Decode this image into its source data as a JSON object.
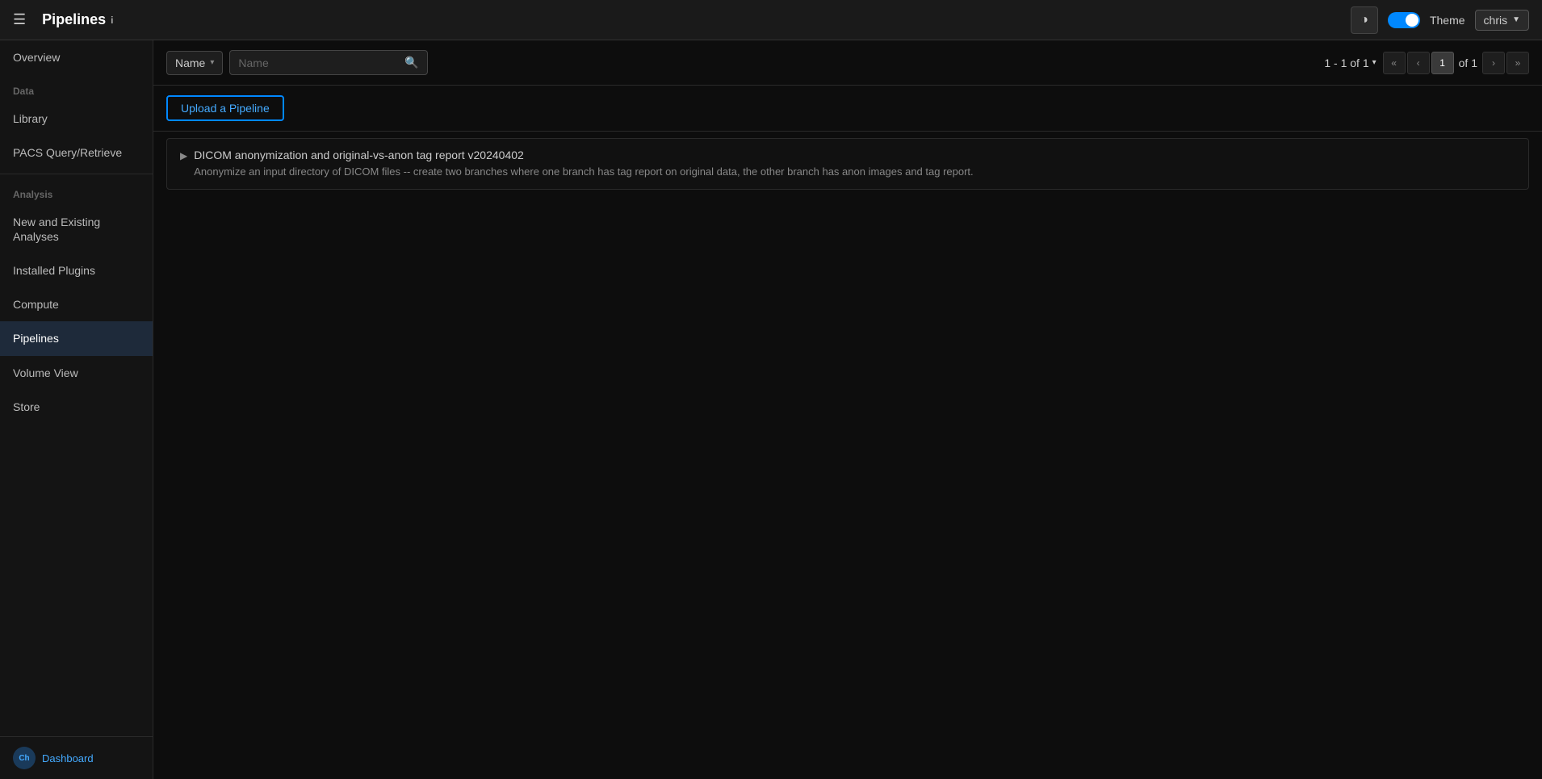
{
  "topnav": {
    "hamburger_label": "☰",
    "title": "Pipelines",
    "title_sup": "i",
    "theme_icon": "◑",
    "theme_label": "Theme",
    "user_label": "chris",
    "user_chevron": "▼"
  },
  "sidebar": {
    "items": [
      {
        "id": "overview",
        "label": "Overview",
        "active": false,
        "section": null
      },
      {
        "id": "data",
        "label": "Data",
        "active": false,
        "section": "section"
      },
      {
        "id": "library",
        "label": "Library",
        "active": false,
        "section": null
      },
      {
        "id": "pacs",
        "label": "PACS Query/Retrieve",
        "active": false,
        "section": null
      },
      {
        "id": "analysis-section",
        "label": "Analysis",
        "active": false,
        "section": "section"
      },
      {
        "id": "new-and-existing",
        "label": "New and Existing Analyses",
        "active": false,
        "section": null
      },
      {
        "id": "installed-plugins",
        "label": "Installed Plugins",
        "active": false,
        "section": null
      },
      {
        "id": "compute",
        "label": "Compute",
        "active": false,
        "section": null
      },
      {
        "id": "pipelines",
        "label": "Pipelines",
        "active": true,
        "section": null
      },
      {
        "id": "volume-view",
        "label": "Volume View",
        "active": false,
        "section": null
      },
      {
        "id": "store",
        "label": "Store",
        "active": false,
        "section": null
      }
    ],
    "bottom": {
      "logo_text": "Ch",
      "dashboard_label": "Dashboard"
    }
  },
  "toolbar": {
    "filter": {
      "label": "Name",
      "chevron": "▾"
    },
    "search": {
      "placeholder": "Name",
      "icon": "🔍"
    },
    "pagination": {
      "range": "1 - 1 of 1",
      "chevron": "▾",
      "current_page": "1",
      "total_pages": "of 1",
      "first": "«",
      "prev": "‹",
      "next": "›",
      "last": "»"
    }
  },
  "upload_btn_label": "Upload a Pipeline",
  "pipelines": [
    {
      "id": "pipeline-1",
      "name": "DICOM anonymization and original-vs-anon tag report v20240402",
      "description": "Anonymize an input directory of DICOM files -- create two branches where one branch has tag report on original data, the other branch has anon images and tag report."
    }
  ]
}
